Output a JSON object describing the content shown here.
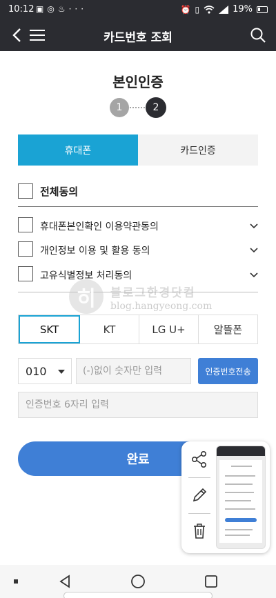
{
  "status_bar": {
    "time": "10:12",
    "battery": "19%",
    "left_icons": [
      "image-icon",
      "chat-icon",
      "notification-icon",
      "more-icon"
    ],
    "right_icons": [
      "alarm-icon",
      "vibrate-icon",
      "wifi-icon",
      "signal-icon"
    ]
  },
  "header": {
    "title": "카드번호 조회"
  },
  "page": {
    "title": "본인인증"
  },
  "steps": [
    "1",
    "2"
  ],
  "tabs": [
    {
      "label": "휴대폰"
    },
    {
      "label": "카드인증"
    }
  ],
  "agreements": {
    "all_label": "전체동의",
    "items": [
      {
        "label": "휴대폰본인확인 이용약관동의"
      },
      {
        "label": "개인정보 이용 및 활용 동의"
      },
      {
        "label": "고유식별정보 처리동의"
      }
    ]
  },
  "carriers": [
    {
      "label": "SKT"
    },
    {
      "label": "KT"
    },
    {
      "label": "LG U+"
    },
    {
      "label": "알뜰폰"
    }
  ],
  "phone": {
    "prefix": "010",
    "placeholder": "(-)없이 숫자만 입력",
    "send_label": "인증번호전송",
    "code_placeholder": "인증번호 6자리 입력"
  },
  "complete_label": "완료",
  "watermark": {
    "logo": "히",
    "text_ko": "블로그한경닷컴",
    "text_en": "blog.hangyeong.com"
  },
  "colors": {
    "header_bg": "#2b2c31",
    "tab_active": "#1aa3d4",
    "button_primary": "#3f7fd6",
    "step_inactive": "#a5a5a5"
  }
}
